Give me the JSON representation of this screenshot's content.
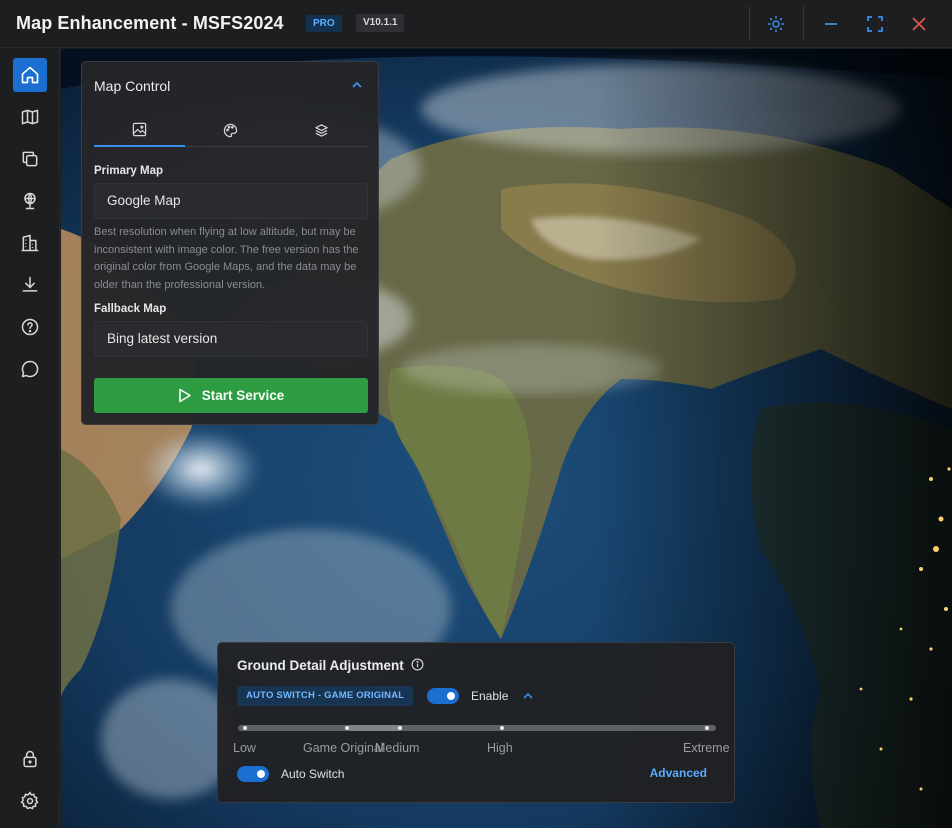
{
  "titlebar": {
    "title": "Map Enhancement - MSFS2024",
    "badge_pro": "PRO",
    "version": "V10.1.1"
  },
  "sidebar": {
    "items": [
      {
        "icon": "home-icon",
        "active": true
      },
      {
        "icon": "map-icon",
        "active": false
      },
      {
        "icon": "layers-copy-icon",
        "active": false
      },
      {
        "icon": "globe-pin-icon",
        "active": false
      },
      {
        "icon": "buildings-icon",
        "active": false
      },
      {
        "icon": "download-icon",
        "active": false
      },
      {
        "icon": "help-icon",
        "active": false
      },
      {
        "icon": "chat-icon",
        "active": false
      }
    ],
    "bottom": [
      {
        "icon": "lock-icon"
      },
      {
        "icon": "settings-icon"
      }
    ]
  },
  "map_control": {
    "title": "Map Control",
    "tabs": [
      {
        "icon": "image-icon",
        "active": true
      },
      {
        "icon": "palette-icon",
        "active": false
      },
      {
        "icon": "stack-icon",
        "active": false
      }
    ],
    "primary_label": "Primary Map",
    "primary_value": "Google Map",
    "description": "Best resolution when flying at low altitude, but may be inconsistent with image color. The free version has the original color from Google Maps, and the data may be older than the professional version.",
    "fallback_label": "Fallback Map",
    "fallback_value": "Bing latest version",
    "start_label": "Start Service"
  },
  "ground_detail": {
    "title": "Ground Detail Adjustment",
    "chip": "AUTO SWITCH - GAME ORIGINAL",
    "enable_label": "Enable",
    "enable_on": true,
    "levels": [
      "Low",
      "Game Original",
      "Medium",
      "High",
      "Extreme"
    ],
    "auto_switch_label": "Auto Switch",
    "auto_switch_on": true,
    "advanced_label": "Advanced"
  },
  "colors": {
    "accent": "#1a6fd1",
    "start": "#2e9c43",
    "link": "#5aabff"
  }
}
